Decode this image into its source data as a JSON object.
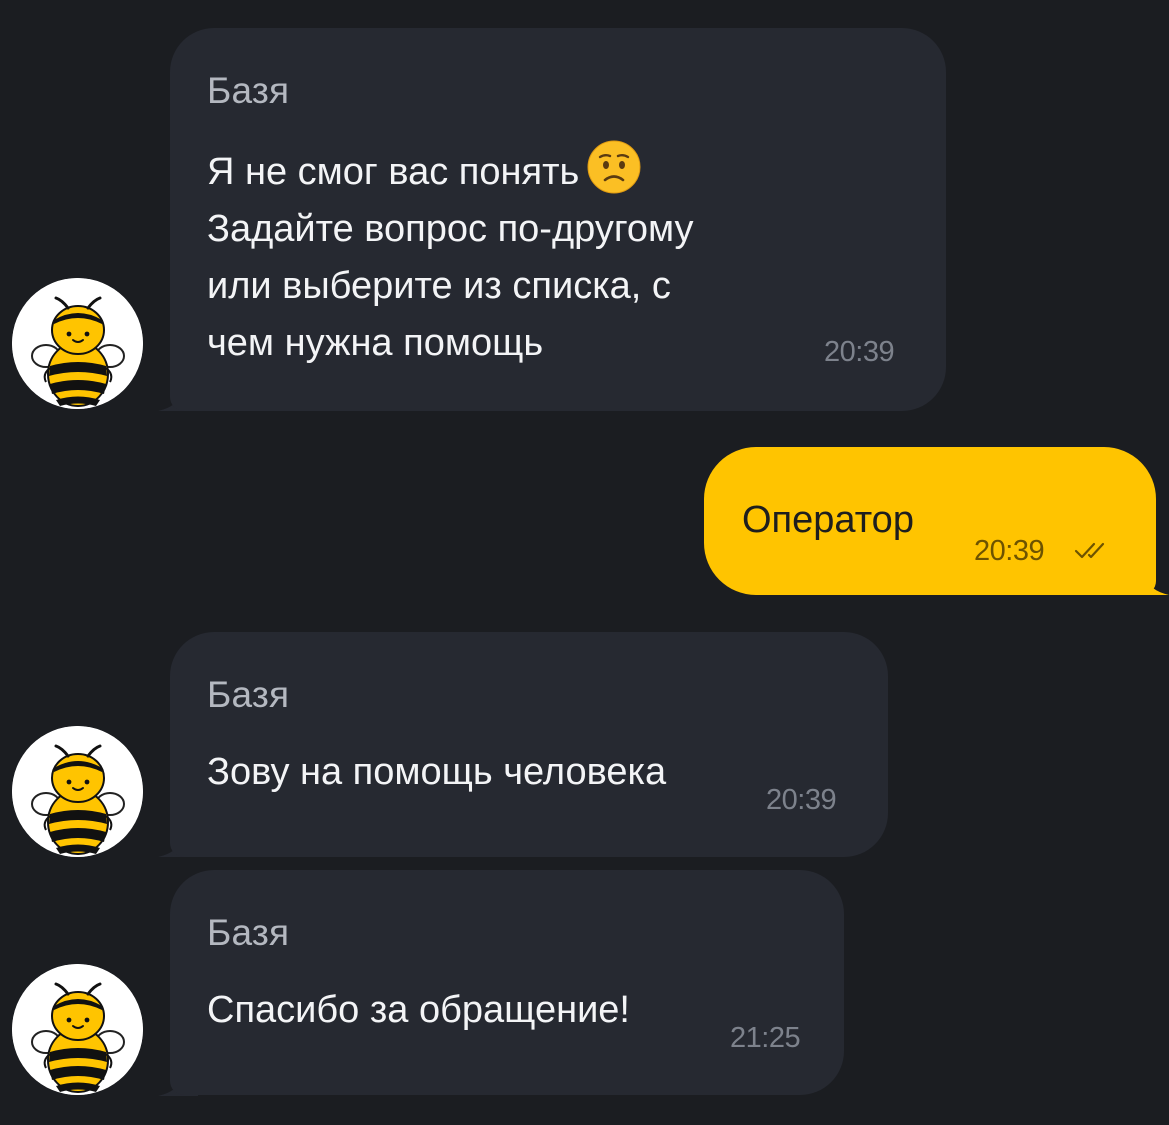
{
  "chat": {
    "messages": [
      {
        "sender": "Базя",
        "lines": [
          "Я не смог вас понять",
          "Задайте вопрос по-другому",
          "или выберите из списка, с",
          "чем нужна помощь"
        ],
        "emoji": "worried-face-icon",
        "time": "20:39"
      },
      {
        "text": "Оператор",
        "time": "20:39",
        "status": "read-double-check-icon"
      },
      {
        "sender": "Базя",
        "text": "Зову на помощь человека",
        "time": "20:39"
      },
      {
        "sender": "Базя",
        "text": "Спасибо за обращение!",
        "time": "21:25"
      }
    ],
    "avatar": "bee-avatar-icon"
  },
  "colors": {
    "background": "#1b1d21",
    "incoming_bubble": "#262931",
    "outgoing_bubble": "#ffc400",
    "accent": "#ffc400"
  }
}
